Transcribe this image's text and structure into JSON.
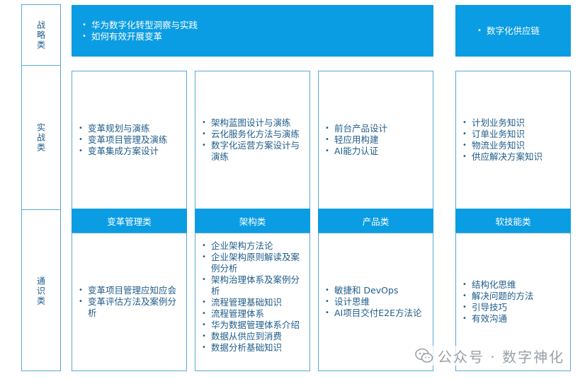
{
  "left_labels": [
    "战略类",
    "实战类",
    "通识类"
  ],
  "strategy": {
    "main_items": [
      "华为数字化转型洞察与实践",
      "如何有效开展变革"
    ],
    "right_items": [
      "数字化供应链"
    ]
  },
  "practice": {
    "change": [
      "变革规划与演练",
      "变革项目管理及演练",
      "变革集成方案设计"
    ],
    "architecture": [
      "架构蓝图设计与演练",
      "云化服务化方法与演练",
      "数字化运营方案设计与演练"
    ],
    "product": [
      "前台产品设计",
      "轻应用构建",
      "AI能力认证"
    ],
    "supply": [
      "计划业务知识",
      "订单业务知识",
      "物流业务知识",
      "供应解决方案知识"
    ]
  },
  "headers": [
    "变革管理类",
    "架构类",
    "产品类",
    "软技能类"
  ],
  "general": {
    "change": [
      "变革项目管理应知应会",
      "变革评估方法及案例分析"
    ],
    "architecture": [
      "企业架构方法论",
      "企业架构原则解读及案例分析",
      "架构治理体系及案例分析",
      "流程管理基础知识",
      "流程管理体系",
      "华为数据管理体系介绍",
      "数据从供应到消费",
      "数据分析基础知识"
    ],
    "product": [
      "敏捷和 DevOps",
      "设计思维",
      "AI项目交付E2E方法论"
    ],
    "soft": [
      "结构化思维",
      "解决问题的方法",
      "引导技巧",
      "有效沟通"
    ]
  },
  "watermark": "公众号 · 数字神化"
}
